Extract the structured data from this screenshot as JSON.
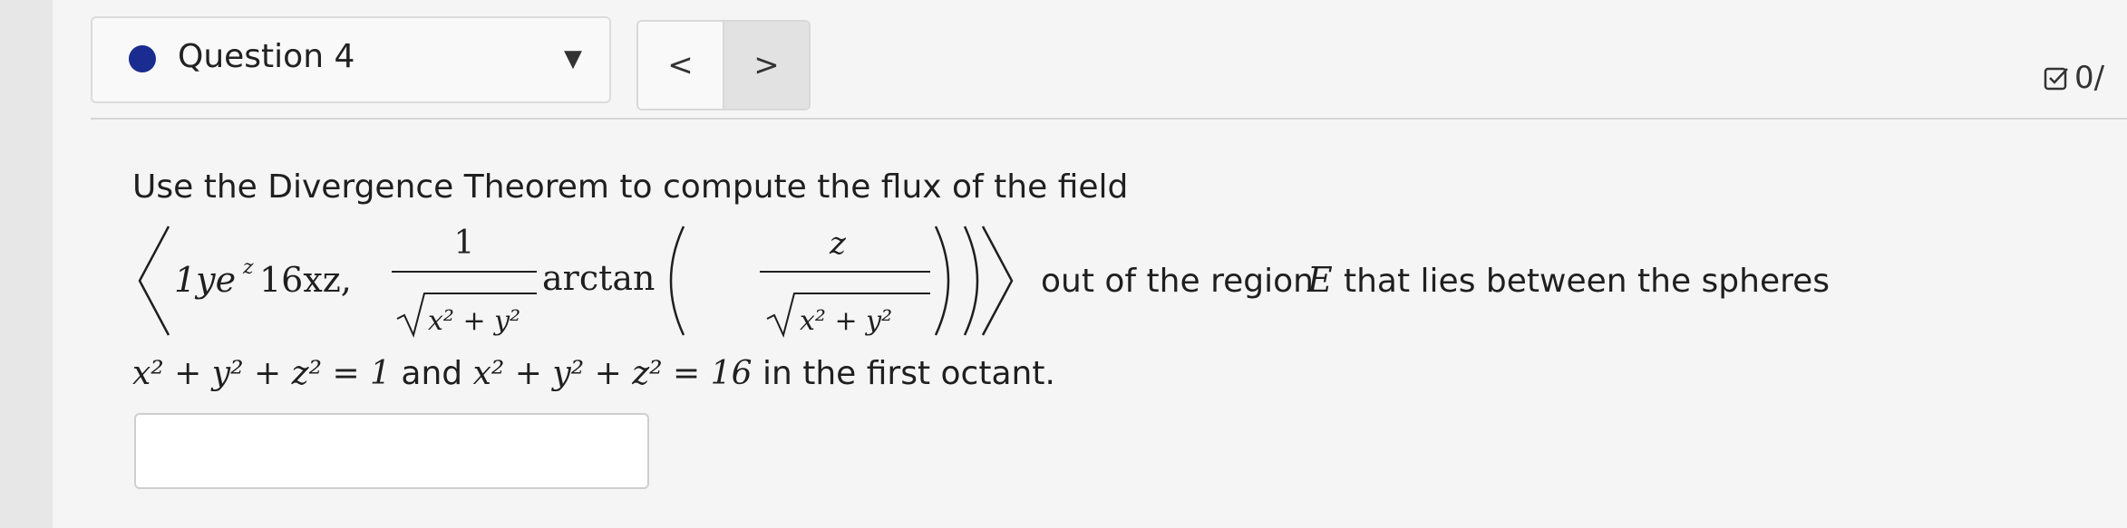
{
  "header": {
    "question_label": "Question 4",
    "dropdown_icon": "caret-down-icon",
    "prev_label": "<",
    "next_label": ">",
    "score": "0/"
  },
  "problem": {
    "intro": "Use the Divergence Theorem to compute the flux of the field",
    "field_c1": "1ye",
    "field_c1_sup": "z",
    "field_c2": "16xz,",
    "frac_num": "1",
    "frac_den": "x² + y²",
    "func": "arctan",
    "inner_num": "z",
    "inner_den": "x² + y²",
    "after_field_1": "out of the region",
    "region": "E",
    "after_field_2": "that lies between the spheres",
    "sphere1": "x² + y² + z² = 1",
    "conj": "and",
    "sphere2": "x² + y² + z² = 16",
    "tail": "in the first octant."
  },
  "answer": {
    "value": ""
  }
}
